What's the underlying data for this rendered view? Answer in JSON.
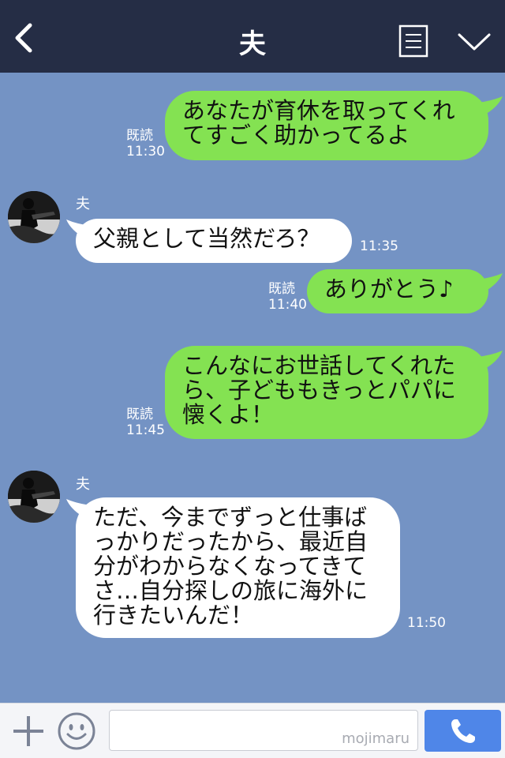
{
  "header": {
    "title": "夫"
  },
  "messages": [
    {
      "dir": "out",
      "text": "あなたが育休を取ってくれ\nてすごく助かってるよ",
      "read": "既読",
      "time": "11:30"
    },
    {
      "dir": "in",
      "sender": "夫",
      "text": "父親として当然だろ？",
      "time": "11:35"
    },
    {
      "dir": "out",
      "text": "ありがとう♪",
      "read": "既読",
      "time": "11:40"
    },
    {
      "dir": "out",
      "text": "こんなにお世話してくれた\nら、子どももきっとパパに\n懐くよ！",
      "read": "既読",
      "time": "11:45"
    },
    {
      "dir": "in",
      "sender": "夫",
      "text": "ただ、今までずっと仕事ば\nっかりだったから、最近自\n分がわからなくなってきて\nさ…自分探しの旅に海外に\n行きたいんだ！",
      "time": "11:50"
    }
  ],
  "footer": {
    "watermark": "mojimaru"
  },
  "colors": {
    "header": "#252d45",
    "background": "#7493c4",
    "outgoing": "#84e252",
    "incoming": "#ffffff",
    "call_button": "#4f86e8"
  },
  "icons": [
    "back-chevron",
    "menu-list",
    "chevron-down",
    "plus",
    "emoji-face",
    "phone"
  ]
}
